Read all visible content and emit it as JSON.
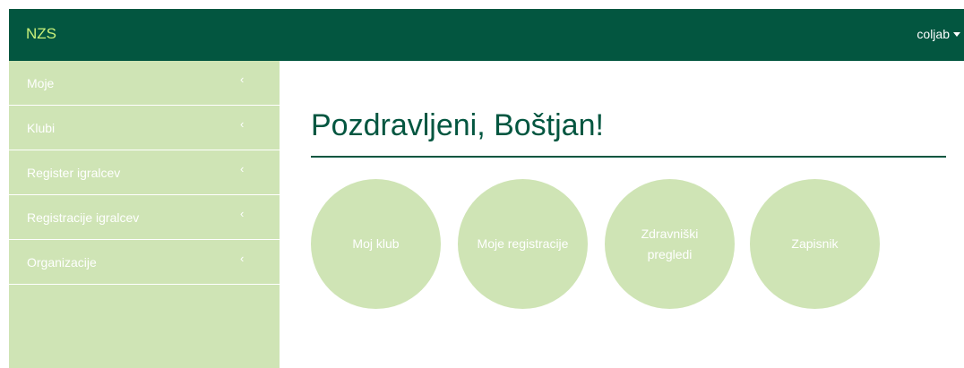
{
  "brand": "NZS",
  "user": {
    "name": "coljab"
  },
  "sidebar": {
    "items": [
      {
        "label": "Moje"
      },
      {
        "label": "Klubi"
      },
      {
        "label": "Register igralcev"
      },
      {
        "label": "Registracije igralcev"
      },
      {
        "label": "Organizacije"
      }
    ]
  },
  "main": {
    "greeting": "Pozdravljeni, Boštjan!",
    "tiles": [
      {
        "label": "Moj klub"
      },
      {
        "label": "Moje registracije"
      },
      {
        "label": "Zdravniški\npregledi"
      },
      {
        "label": "Zapisnik"
      }
    ]
  },
  "colors": {
    "navbar": "#035640",
    "brand_text": "#c9f17a",
    "sidebar_bg": "#cfe4b5",
    "tile_bg": "#cfe4b5",
    "title_text": "#035640"
  },
  "icons": {
    "sidebar_chevron": "chevron-left-icon",
    "user_caret": "caret-down-icon"
  }
}
